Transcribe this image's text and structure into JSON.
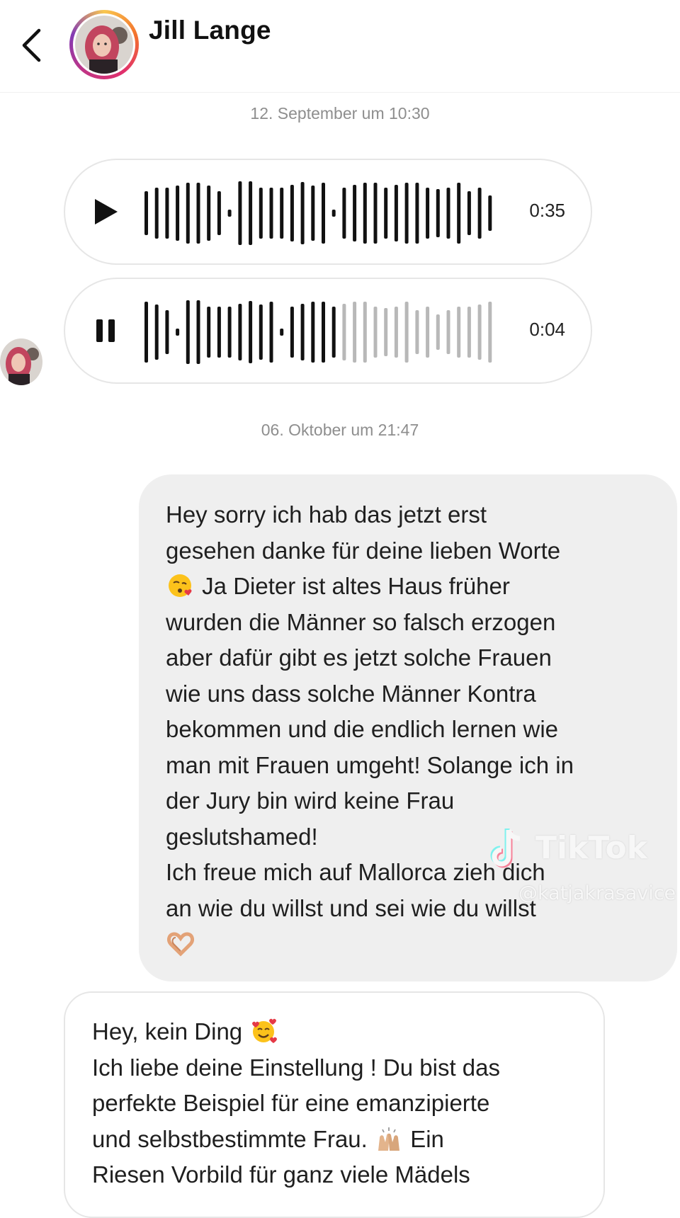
{
  "header": {
    "contact_name": "Jill Lange",
    "back_icon": "chevron-left-icon"
  },
  "chat": {
    "timestamp_1": "12. September um 10:30",
    "voice_messages": [
      {
        "state": "paused",
        "duration": "0:35",
        "played_fraction": 1.0,
        "icon": "play-icon"
      },
      {
        "state": "playing",
        "duration": "0:04",
        "played_fraction": 0.55,
        "icon": "pause-icon"
      }
    ],
    "timestamp_2": "06. Oktober um 21:47",
    "outgoing_message": {
      "text_part1": "Hey sorry ich hab das jetzt erst\ngesehen danke für deine lieben Worte",
      "emoji_1": "kissing-heart-emoji",
      "text_part2": "Ja Dieter ist altes Haus früher\nwurden die Männer so falsch erzogen\naber dafür gibt es jetzt solche Frauen\nwie uns dass solche Männer Kontra\nbekommen und die endlich lernen wie\nman mit Frauen umgeht! Solange ich in\nder Jury bin wird keine Frau\ngeslutshamed!\nIch freue mich auf Mallorca zieh dich\nan wie du willst und sei wie du willst",
      "emoji_2": "heart-hands-emoji"
    },
    "incoming_message": {
      "text_part1": "Hey, kein Ding",
      "emoji_1": "smiling-face-with-hearts-emoji",
      "text_part2": "Ich liebe deine Einstellung ! Du bist das\nperfekte Beispiel für eine emanzipierte\nund selbstbestimmte Frau.",
      "emoji_2": "raising-hands-emoji",
      "text_part3": "Ein",
      "text_part4": "Riesen Vorbild für ganz viele Mädels"
    }
  },
  "watermark": {
    "brand": "TikTok",
    "handle": "@katjakrasavice"
  },
  "colors": {
    "timestamp": "#8e8e8e",
    "outgoing_bubble": "#efefef",
    "bubble_border": "#e6e6e6",
    "wave_played": "#111111",
    "wave_unplayed": "#b8b8b8"
  }
}
